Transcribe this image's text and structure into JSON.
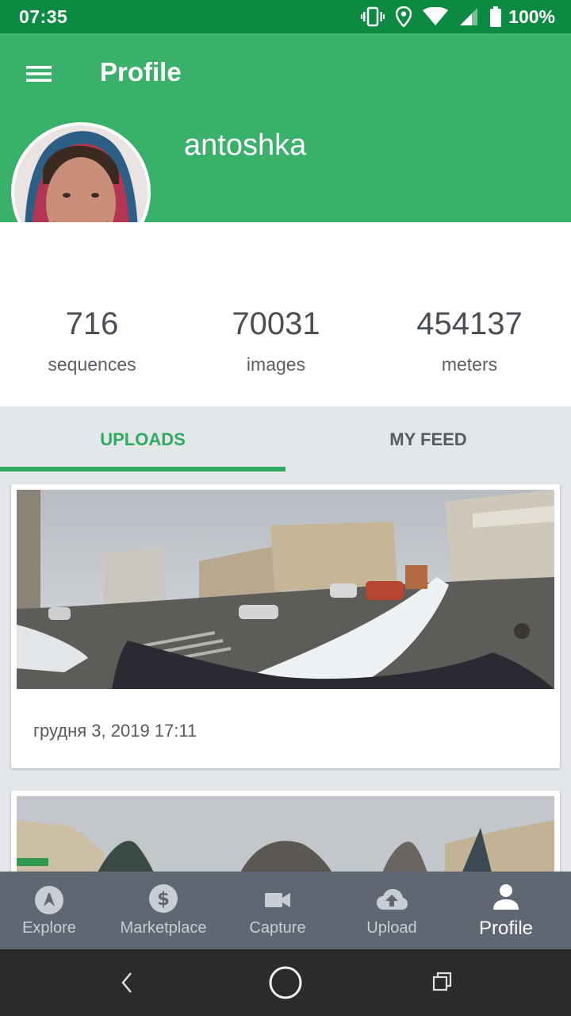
{
  "status_bar": {
    "time": "07:35",
    "battery": "100%"
  },
  "header": {
    "title": "Profile",
    "username": "antoshka"
  },
  "stats": [
    {
      "value": "716",
      "label": "sequences"
    },
    {
      "value": "70031",
      "label": "images"
    },
    {
      "value": "454137",
      "label": "meters"
    }
  ],
  "tabs": {
    "uploads": "UPLOADS",
    "my_feed": "MY FEED",
    "active": "UPLOADS"
  },
  "uploads": [
    {
      "date": "грудня 3, 2019 17:11"
    },
    {
      "date": ""
    }
  ],
  "bottom_nav": {
    "items": [
      {
        "label": "Explore",
        "icon": "explore-icon"
      },
      {
        "label": "Marketplace",
        "icon": "dollar-icon"
      },
      {
        "label": "Capture",
        "icon": "videocam-icon"
      },
      {
        "label": "Upload",
        "icon": "cloud-upload-icon"
      },
      {
        "label": "Profile",
        "icon": "person-icon"
      }
    ],
    "active": "Profile"
  },
  "colors": {
    "status_bar": "#0d8a42",
    "header": "#39b16b",
    "accent": "#2eaa62",
    "bottom_nav": "#5f6772",
    "system_nav": "#2b2b2b"
  }
}
